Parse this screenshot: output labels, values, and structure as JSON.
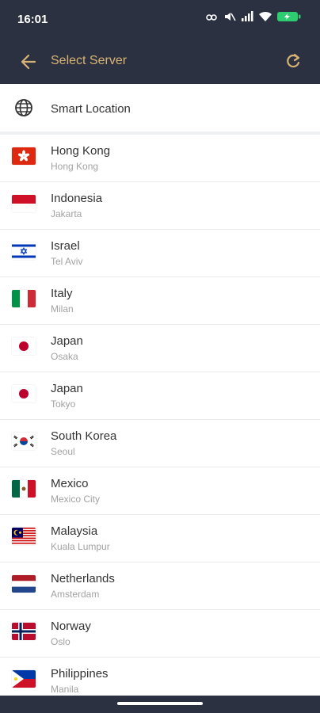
{
  "status": {
    "time": "16:01"
  },
  "header": {
    "title": "Select Server"
  },
  "smart": {
    "label": "Smart Location"
  },
  "servers": [
    {
      "country": "Hong Kong",
      "city": "Hong Kong"
    },
    {
      "country": "Indonesia",
      "city": "Jakarta"
    },
    {
      "country": "Israel",
      "city": "Tel Aviv"
    },
    {
      "country": "Italy",
      "city": "Milan"
    },
    {
      "country": "Japan",
      "city": "Osaka"
    },
    {
      "country": "Japan",
      "city": "Tokyo"
    },
    {
      "country": "South Korea",
      "city": "Seoul"
    },
    {
      "country": "Mexico",
      "city": "Mexico City"
    },
    {
      "country": "Malaysia",
      "city": "Kuala Lumpur"
    },
    {
      "country": "Netherlands",
      "city": "Amsterdam"
    },
    {
      "country": "Norway",
      "city": "Oslo"
    },
    {
      "country": "Philippines",
      "city": "Manila"
    }
  ],
  "colors": {
    "bar": "#2b3140",
    "accent": "#d9b375",
    "battery": "#2ecc71"
  }
}
